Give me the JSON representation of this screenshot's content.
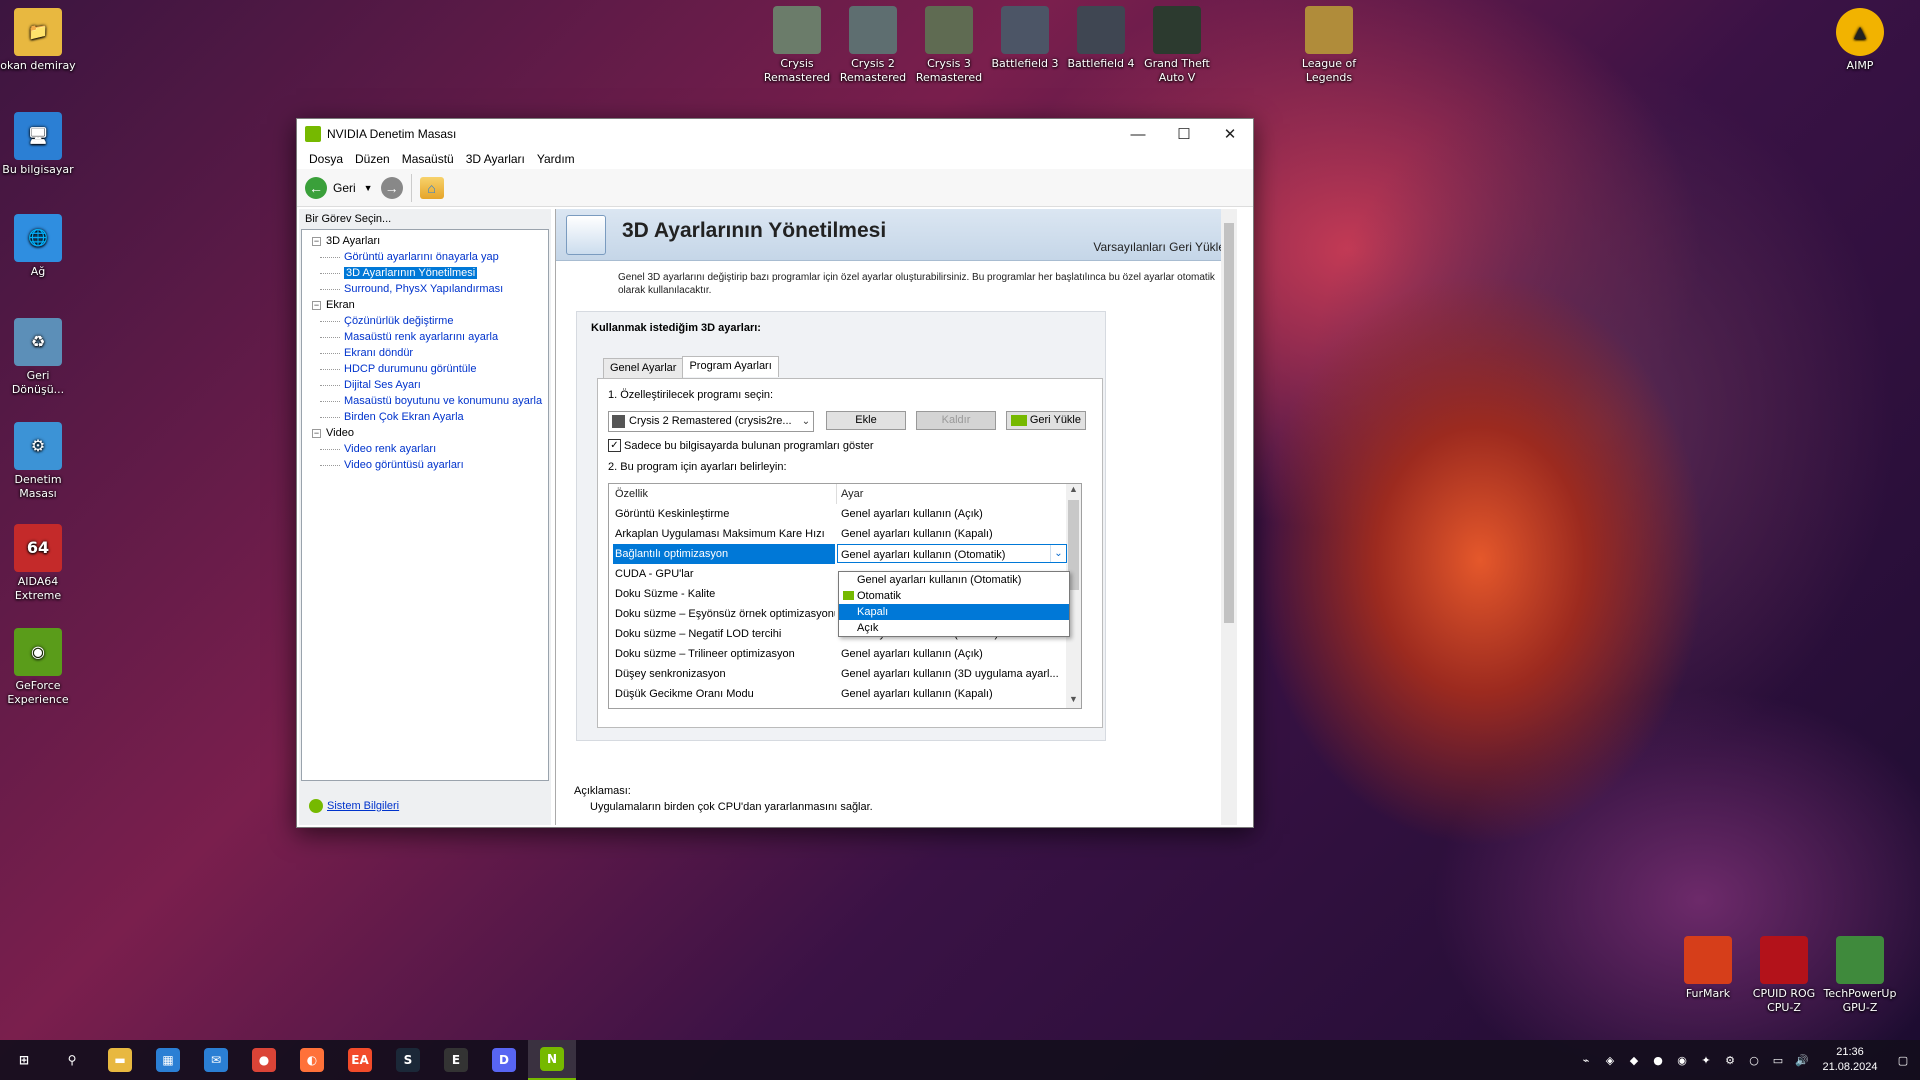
{
  "desktop": {
    "icons_left": [
      {
        "label": "okan demiray",
        "color": "#e8b840",
        "glyph": "📁",
        "icon": "user-folder-icon"
      },
      {
        "label": "Bu bilgisayar",
        "color": "#2b7fd4",
        "glyph": "🖥",
        "icon": "computer-icon"
      },
      {
        "label": "Ağ",
        "color": "#2f8ee0",
        "glyph": "🌐",
        "icon": "network-icon"
      },
      {
        "label": "Geri Dönüşü...",
        "color": "#5c8fb8",
        "glyph": "♻",
        "icon": "recycle-bin-icon"
      },
      {
        "label": "Denetim Masası",
        "color": "#3c93d6",
        "glyph": "⚙",
        "icon": "control-panel-icon"
      },
      {
        "label": "AIDA64 Extreme",
        "color": "#c42a2a",
        "glyph": "64",
        "icon": "aida64-icon"
      },
      {
        "label": "GeForce Experience",
        "color": "#5a9c1a",
        "glyph": "◉",
        "icon": "geforce-icon"
      }
    ],
    "icons_top": [
      {
        "label": "Crysis Remastered",
        "color": "#6b7c6a",
        "icon": "crysis-icon"
      },
      {
        "label": "Crysis 2 Remastered",
        "color": "#5e6e70",
        "icon": "crysis2-icon"
      },
      {
        "label": "Crysis 3 Remastered",
        "color": "#5f6b52",
        "icon": "crysis3-icon"
      },
      {
        "label": "Battlefield 3",
        "color": "#4c5566",
        "icon": "battlefield3-icon"
      },
      {
        "label": "Battlefield 4",
        "color": "#3f4652",
        "icon": "battlefield4-icon"
      },
      {
        "label": "Grand Theft Auto V",
        "color": "#2c3a2f",
        "icon": "gta5-icon"
      },
      {
        "label": "League of Legends",
        "color": "#b08c3a",
        "icon": "lol-icon"
      }
    ],
    "icon_aimp": {
      "label": "AIMP",
      "color": "#f2b300"
    },
    "icons_bottom_right": [
      {
        "label": "FurMark",
        "color": "#d63e1a",
        "icon": "furmark-icon"
      },
      {
        "label": "CPUID ROG CPU-Z",
        "color": "#b3121a",
        "icon": "cpuz-icon"
      },
      {
        "label": "TechPowerUp GPU-Z",
        "color": "#3f8a3c",
        "icon": "gpuz-icon"
      }
    ]
  },
  "window": {
    "title": "NVIDIA Denetim Masası",
    "menu": [
      "Dosya",
      "Düzen",
      "Masaüstü",
      "3D Ayarları",
      "Yardım"
    ],
    "back_label": "Geri",
    "task_label": "Bir Görev Seçin...",
    "tree": [
      {
        "type": "cat",
        "label": "3D Ayarları"
      },
      {
        "type": "item",
        "label": "Görüntü ayarlarını önayarla yap"
      },
      {
        "type": "item",
        "label": "3D Ayarlarının Yönetilmesi",
        "selected": true
      },
      {
        "type": "item",
        "label": "Surround, PhysX Yapılandırması"
      },
      {
        "type": "cat",
        "label": "Ekran"
      },
      {
        "type": "item",
        "label": "Çözünürlük değiştirme"
      },
      {
        "type": "item",
        "label": "Masaüstü renk ayarlarını ayarla"
      },
      {
        "type": "item",
        "label": "Ekranı döndür"
      },
      {
        "type": "item",
        "label": "HDCP durumunu görüntüle"
      },
      {
        "type": "item",
        "label": "Dijital Ses Ayarı"
      },
      {
        "type": "item",
        "label": "Masaüstü boyutunu ve konumunu ayarla"
      },
      {
        "type": "item",
        "label": "Birden Çok Ekran Ayarla"
      },
      {
        "type": "cat",
        "label": "Video"
      },
      {
        "type": "item",
        "label": "Video renk ayarları"
      },
      {
        "type": "item",
        "label": "Video görüntüsü ayarları"
      }
    ],
    "system_info": "Sistem Bilgileri",
    "page_title": "3D Ayarlarının Yönetilmesi",
    "restore_defaults": "Varsayılanları Geri Yükle",
    "description": "Genel 3D ayarlarını değiştirip bazı programlar için özel ayarlar oluşturabilirsiniz. Bu programlar her başlatılınca bu özel ayarlar otomatik olarak kullanılacaktır.",
    "group_title": "Kullanmak istediğim 3D ayarları:",
    "tabs": [
      "Genel Ayarlar",
      "Program Ayarları"
    ],
    "step1": "1. Özelleştirilecek programı seçin:",
    "program_value": "Crysis 2 Remastered (crysis2re...",
    "btn_add": "Ekle",
    "btn_remove": "Kaldır",
    "btn_restore": "Geri Yükle",
    "show_only_label": "Sadece bu bilgisayarda bulunan programları göster",
    "step2": "2. Bu program için ayarları belirleyin:",
    "col_feature": "Özellik",
    "col_setting": "Ayar",
    "rows": [
      {
        "feature": "Görüntü Keskinleştirme",
        "setting": "Genel ayarları kullanın (Açık)"
      },
      {
        "feature": "Arkaplan Uygulaması Maksimum Kare Hızı",
        "setting": "Genel ayarları kullanın (Kapalı)"
      },
      {
        "feature": "Bağlantılı optimizasyon",
        "setting": "Genel ayarları kullanın (Otomatik)"
      },
      {
        "feature": "CUDA - GPU'lar",
        "setting": ""
      },
      {
        "feature": "Doku Süzme - Kalite",
        "setting": ""
      },
      {
        "feature": "Doku süzme – Eşyönsüz örnek optimizasyonu",
        "setting": ""
      },
      {
        "feature": "Doku süzme – Negatif LOD tercihi",
        "setting": "Genel ayarları kullanın (İzin Ver)"
      },
      {
        "feature": "Doku süzme – Trilineer optimizasyon",
        "setting": "Genel ayarları kullanın (Açık)"
      },
      {
        "feature": "Düşey senkronizasyon",
        "setting": "Genel ayarları kullanın (3D uygulama ayarl..."
      },
      {
        "feature": "Düşük Gecikme Oranı Modu",
        "setting": "Genel ayarları kullanın (Kapalı)"
      }
    ],
    "dropdown_options": [
      "Genel ayarları kullanın (Otomatik)",
      "Otomatik",
      "Kapalı",
      "Açık"
    ],
    "dropdown_highlight": 2,
    "description_label": "Açıklaması:",
    "description_text": "Uygulamaların birden çok CPU'dan yararlanmasını sağlar."
  },
  "taskbar": {
    "apps": [
      {
        "name": "start",
        "glyph": "⊞",
        "color": "transparent"
      },
      {
        "name": "search",
        "glyph": "⚲",
        "color": "transparent"
      },
      {
        "name": "file-explorer",
        "glyph": "▬",
        "color": "#e8b840"
      },
      {
        "name": "store",
        "glyph": "▦",
        "color": "#2b7fd4"
      },
      {
        "name": "mail",
        "glyph": "✉",
        "color": "#2b7fd4"
      },
      {
        "name": "chrome",
        "glyph": "●",
        "color": "#db4437"
      },
      {
        "name": "firefox",
        "glyph": "◐",
        "color": "#ff7139"
      },
      {
        "name": "ea",
        "glyph": "EA",
        "color": "#f24b2a"
      },
      {
        "name": "steam",
        "glyph": "S",
        "color": "#1b2838"
      },
      {
        "name": "epic",
        "glyph": "E",
        "color": "#333"
      },
      {
        "name": "discord",
        "glyph": "D",
        "color": "#5865f2"
      },
      {
        "name": "nvidia",
        "glyph": "N",
        "color": "#76b900"
      }
    ],
    "time": "21:36",
    "date": "21.08.2024"
  }
}
